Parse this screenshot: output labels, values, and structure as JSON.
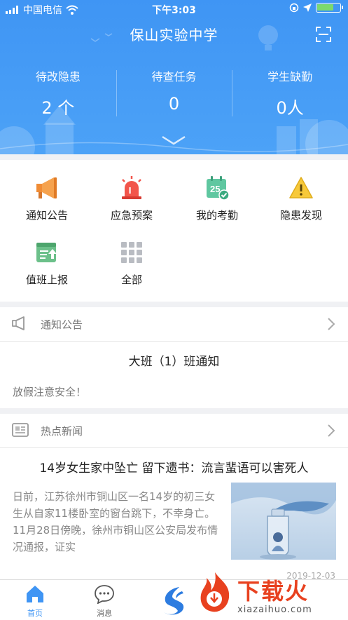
{
  "status_bar": {
    "carrier": "中国电信",
    "time": "下午3:03",
    "battery_level": 0.75
  },
  "header": {
    "title": "保山实验中学",
    "stats": [
      {
        "label": "待改隐患",
        "value": "2 个"
      },
      {
        "label": "待查任务",
        "value": "0"
      },
      {
        "label": "学生缺勤",
        "value": "0人"
      }
    ]
  },
  "functions": [
    {
      "label": "通知公告",
      "icon": "megaphone-icon"
    },
    {
      "label": "应急预案",
      "icon": "alarm-light-icon"
    },
    {
      "label": "我的考勤",
      "icon": "calendar-check-icon",
      "icon_text": "25"
    },
    {
      "label": "隐患发现",
      "icon": "warning-icon"
    },
    {
      "label": "值班上报",
      "icon": "duty-report-icon"
    },
    {
      "label": "全部",
      "icon": "grid-icon"
    }
  ],
  "notice": {
    "heading": "通知公告",
    "title": "大班（1）班通知",
    "body": "放假注意安全！"
  },
  "news": {
    "heading": "热点新闻",
    "title": "14岁女生家中坠亡 留下遗书：流言蜚语可以害死人",
    "body": "日前，江苏徐州市铜山区一名14岁的初三女生从自家11楼卧室的窗台跳下，不幸身亡。11月28日傍晚，徐州市铜山区公安局发布情况通报，证实",
    "date": "2019-12-03"
  },
  "tabs": [
    {
      "label": "首页",
      "icon": "home-icon",
      "active": true
    },
    {
      "label": "消息",
      "icon": "chat-icon",
      "active": false
    }
  ],
  "watermark": {
    "text": "下载火",
    "url": "xiazaihuo.com"
  },
  "colors": {
    "primary": "#3f95f4",
    "accent_red": "#e8411f"
  }
}
